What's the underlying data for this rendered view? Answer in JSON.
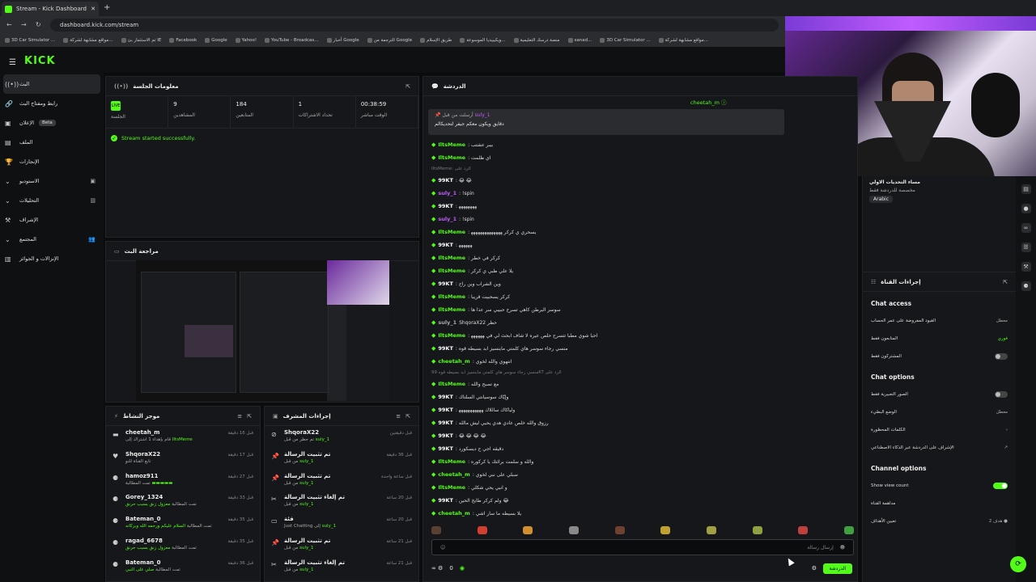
{
  "browser": {
    "tab_title": "Stream - Kick Dashboard",
    "new_tab": "+",
    "url": "dashboard.kick.com/stream",
    "bookmarks": [
      "3D Car Simulator ...",
      "مواقع مشابهة لشركة...",
      "ﺗﻢ ﺍﻻﺳﺘﺜﻤﺎﺭ ﺑﺊ IE",
      "Facebook",
      "Google",
      "Yahoo!",
      "YouTube - Broadcas...",
      "أخبار Google",
      "الترجمة من Google",
      "طريق الإسلام",
      "ويكيبيديا الموسوعة...",
      "منصة درسك التعليمية",
      "sanad...",
      "3D Car Simulator ...",
      "مواقع مشابهة لشركة..."
    ]
  },
  "header": {
    "logo": "KICK",
    "menu_icon": "☰"
  },
  "sidebar": {
    "items": [
      {
        "label": "البث",
        "icon": "((•))",
        "active": true
      },
      {
        "label": "رابط ومفتاح البث",
        "icon": "🔗"
      },
      {
        "label": "الإعلان",
        "icon": "▣",
        "badge": "Beta"
      },
      {
        "label": "الملف",
        "icon": "▤"
      },
      {
        "label": "الإنجازات",
        "icon": "🏆"
      },
      {
        "label": "الاستوديو",
        "icon": "⌄",
        "right": "▣"
      },
      {
        "label": "التحليلات",
        "icon": "⌄",
        "right": "▥"
      },
      {
        "label": "الإشراف",
        "icon": "⚒"
      },
      {
        "label": "المجتمع",
        "icon": "⌄",
        "right": "👥"
      },
      {
        "label": "الإنزالات و الجوائز",
        "icon": "▥"
      }
    ]
  },
  "session": {
    "title": "معلومات الجلسة",
    "stats": [
      {
        "value": "",
        "label": "الجلسة",
        "badge": "LIVE"
      },
      {
        "value": "9",
        "label": "المشاهدين"
      },
      {
        "value": "184",
        "label": "المتابعين"
      },
      {
        "value": "1",
        "label": "تحداد الاشتراكات"
      },
      {
        "value": "00:38:59",
        "label": "الوقت مباشر"
      }
    ],
    "success": "Stream started successfully."
  },
  "preview": {
    "title": "مراجعة البث"
  },
  "activity": {
    "title": "موجز النشاط",
    "items": [
      {
        "name": "cheetah_m",
        "sub": "قام بإهداء 1 اشتراك إلى",
        "hi": "IltsMeme",
        "time": "قبل 16 دقيقة",
        "icon": "▬"
      },
      {
        "name": "ShqoraX22",
        "sub": "تابع القناة للتو",
        "hi": "",
        "time": "قبل 17 دقيقة",
        "icon": "♥"
      },
      {
        "name": "hamoz911",
        "sub": "تمت المطالبة",
        "hi": "▬▬▬▬▬",
        "time": "قبل 27 دقيقة",
        "icon": "⚈"
      },
      {
        "name": "Gorey_1324",
        "sub": "تمت المطالبة",
        "hi": "معزول زنق بسبب حرنق",
        "time": "قبل 33 دقيقة",
        "icon": "⚈"
      },
      {
        "name": "Bateman_0",
        "sub": "تمت المطالبة",
        "hi": "السلام عليكم ورحمه الله وبركاته",
        "time": "قبل 35 دقيقة",
        "icon": "⚈"
      },
      {
        "name": "ragad_6678",
        "sub": "تمت المطالبة",
        "hi": "معزول زنق بسبب حرنق",
        "time": "قبل 35 دقيقة",
        "icon": "⚈"
      },
      {
        "name": "Bateman_0",
        "sub": "تمت المطالبة",
        "hi": "صلي على النبي",
        "time": "قبل 36 دقيقة",
        "icon": "⚈"
      }
    ]
  },
  "modactions": {
    "title": "إجراءات المشرف",
    "items": [
      {
        "name": "ShqoraX22",
        "sub": "تم حظر من قبل",
        "hi": "suly_1",
        "time": "قبل دقيقتين",
        "icon": "⊘"
      },
      {
        "name": "تم تثبيت الرسالة",
        "sub": "من قبل",
        "hi": "suly_1",
        "time": "قبل 36 دقيقة",
        "icon": "📌"
      },
      {
        "name": "تم تثبيت الرسالة",
        "sub": "من قبل",
        "hi": "suly_1",
        "time": "قبل ساعة واحدة",
        "icon": "📌"
      },
      {
        "name": "تم إلغاء تثبيت الرسالة",
        "sub": "من قبل",
        "hi": "suly_1",
        "time": "قبل 20 ساعة",
        "icon": "✂"
      },
      {
        "name": "فئة",
        "sub": "Just Chatting إلى",
        "hi": "suly_1",
        "time": "قبل 20 ساعة",
        "icon": "▭"
      },
      {
        "name": "تم تثبيت الرسالة",
        "sub": "من قبل",
        "hi": "suly_1",
        "time": "قبل 21 ساعة",
        "icon": "📌"
      },
      {
        "name": "تم إلغاء تثبيت الرسالة",
        "sub": "من قبل",
        "hi": "suly_1",
        "time": "قبل 21 ساعة",
        "icon": "✂"
      }
    ]
  },
  "chat": {
    "title": "الدردشة",
    "pinned_user": "cheetah_m",
    "pinned_by": "أرسلت من قبل",
    "pinned_name": "suly_1",
    "pinned_text": "دقايق ويكون معكم جيفر لتحديكالم",
    "messages": [
      {
        "user": "IltsMeme",
        "text": ": بيبر عشتب",
        "color": "#53fc18"
      },
      {
        "user": "IltsMeme",
        "text": ": اي ظلمت",
        "color": "#53fc18"
      },
      {
        "user": "",
        "text": "IltsMeme: الرد على",
        "color": "#777",
        "sys": true
      },
      {
        "user": "99KT",
        "text": ": 😂 😂",
        "color": "#fff"
      },
      {
        "user": "suly_1",
        "text": ": !spin",
        "color": "#c05cff"
      },
      {
        "user": "99KT",
        "text": ": ﻬﻬﻬﻬﻬﻬﻬﻬ",
        "color": "#fff"
      },
      {
        "user": "suly_1",
        "text": ": !spin",
        "color": "#c05cff"
      },
      {
        "user": "IltsMeme",
        "text": ": يسحري ي كركر ﻬﻬﻬﻬﻬﻬﻬﻬﻬﻬﻬﻬﻬﻬ",
        "color": "#53fc18"
      },
      {
        "user": "99KT",
        "text": ": ﻬﻬﻬﻬﻬﻬ",
        "color": "#fff"
      },
      {
        "user": "IltsMeme",
        "text": ": كركر في خطر",
        "color": "#53fc18"
      },
      {
        "user": "IltsMeme",
        "text": ": يلا علي ظبي ي كركر",
        "color": "#53fc18"
      },
      {
        "user": "99KT",
        "text": ": وين الشراب وين راح",
        "color": "#fff"
      },
      {
        "user": "IltsMeme",
        "text": ": كركر يسحبيت قريبا",
        "color": "#53fc18"
      },
      {
        "user": "IltsMeme",
        "text": ": سوسر البرطن كاهي تسرح حبيبي سر عذا ها",
        "color": "#53fc18"
      },
      {
        "user": "suly_1",
        "text": "ShqoraX22 حظر",
        "color": "#aaa",
        "sys2": true
      },
      {
        "user": "IltsMeme",
        "text": ": احبا شوي مطبا تتسرح حلص عيره لا شاف ابحث لي في ﻬﻬﻬﻬﻬﻬ",
        "color": "#53fc18"
      },
      {
        "user": "99KT",
        "text": ": منسي رجاء سوسر هاي كلمتي ماينسيز ابد بسيطه قوه",
        "color": "#fff"
      },
      {
        "user": "cheetah_m",
        "text": ": انتهوي والله لخوي",
        "color": "#53fc18"
      },
      {
        "user": "",
        "text": "منسي رجاء سوسر هاي كلمتي ماينسيز ابد بسيطه قوه 99KT الرد على",
        "color": "#777",
        "sys": true
      },
      {
        "user": "IltsMeme",
        "text": ": مع تصبح والله",
        "color": "#53fc18"
      },
      {
        "user": "99KT",
        "text": ": وإيّاك سوسيانتي السلتاك",
        "color": "#fff"
      },
      {
        "user": "99KT",
        "text": ": ولياكاك ساللاك ﻬﻬﻬﻬﻬﻬﻬﻬﻬﻬﻬ",
        "color": "#fff"
      },
      {
        "user": "99KT",
        "text": ": رزوق والله خلص عادي هدي يحيي ليش مالله",
        "color": "#fff"
      },
      {
        "user": "99KT",
        "text": ": 😂 😂 😂 😂",
        "color": "#fff"
      },
      {
        "user": "99KT",
        "text": ": دقيقه اجي ح ديسكورد",
        "color": "#fff"
      },
      {
        "user": "IltsMeme",
        "text": ": والله و سلمت برائتك يا كركوره",
        "color": "#53fc18"
      },
      {
        "user": "cheetah_m",
        "text": ": سبلي على نبي لخوي",
        "color": "#53fc18"
      },
      {
        "user": "IltsMeme",
        "text": ": و انبي يحي شكلي",
        "color": "#53fc18"
      },
      {
        "user": "99KT",
        "text": ": ولم كركر طايخ الحين 😂",
        "color": "#fff"
      },
      {
        "user": "cheetah_m",
        "text": ": يلا بسيطه ما سار اشي",
        "color": "#53fc18"
      }
    ],
    "emotes_label": "المشتركين فقط",
    "input_placeholder": "إرسال رسالة",
    "send": "الدردشة",
    "viewer_count": "0"
  },
  "right": {
    "user_tag": "مساء التحديات الاولي",
    "user_desc": "مخصصة للدردشة فقط",
    "language": "Arabic",
    "channel_actions": "إجراءات القناة",
    "chat_access": "Chat access",
    "access_rows": [
      {
        "label": "القيود المفروضة على عمر الحساب",
        "value": "معطل"
      },
      {
        "label": "المتابعون فقط",
        "value": "فوري",
        "green": true
      },
      {
        "label": "المشتركون فقط",
        "toggle": false
      }
    ],
    "chat_options": "Chat options",
    "option_rows": [
      {
        "label": "الصور التعبيرية فقط",
        "toggle": false
      },
      {
        "label": "الوضع البطيء",
        "value": "معطل"
      },
      {
        "label": "الكلمات المحظورة",
        "value": "›"
      },
      {
        "label": "الإشراف على الدردشة عبر الذكاء الاصطناعي",
        "value": "↗"
      }
    ],
    "channel_options": "Channel options",
    "channel_rows": [
      {
        "label": "Show view count",
        "toggle": true
      },
      {
        "label": "مداهمة القناة",
        "value": ""
      },
      {
        "label": "تعيين الأهداف",
        "value": "هدف 2 ●"
      }
    ]
  },
  "colors": {
    "accent": "#53fc18",
    "bg": "#0b0c0e",
    "panel": "#16171a"
  }
}
